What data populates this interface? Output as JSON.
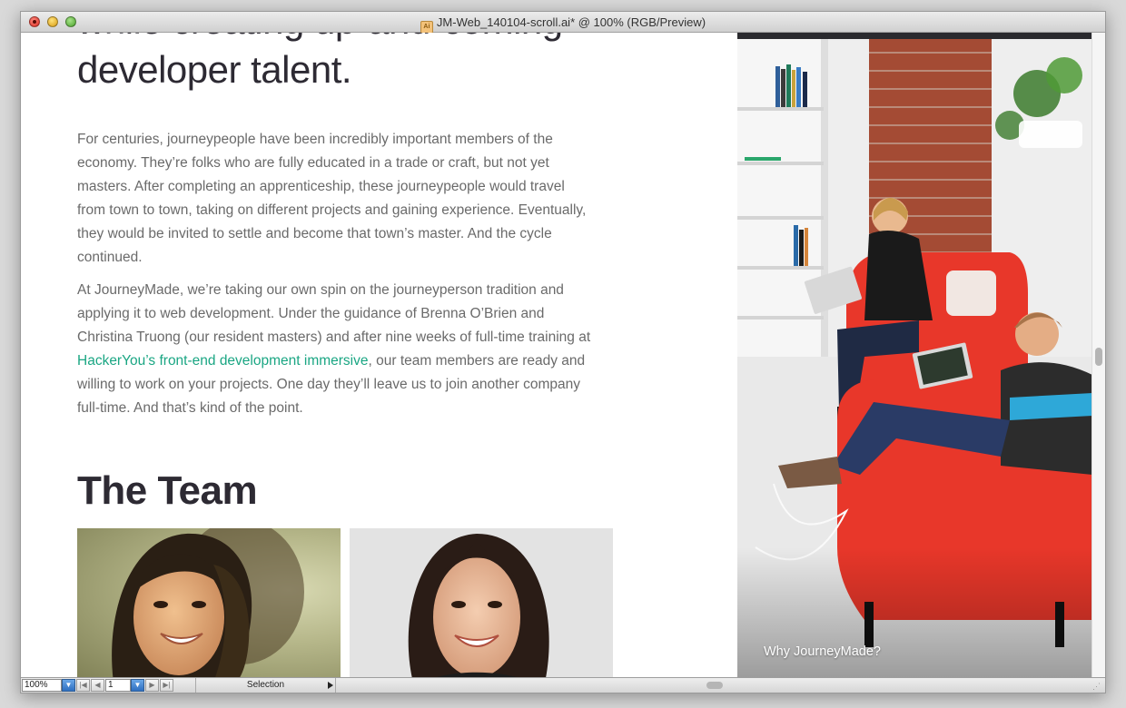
{
  "window": {
    "title": "JM-Web_140104-scroll.ai* @ 100% (RGB/Preview)",
    "doc_icon_label": "Ai"
  },
  "content": {
    "headline_line1": "while creating up-and-coming",
    "headline_line2": "developer talent.",
    "paragraph1": "For centuries, journeypeople have been incredibly important members of the economy. They’re folks who are fully educated in a trade or craft, but not yet masters. After completing an apprenticeship, these journeypeople would travel from town to town, taking on different projects and gaining experience. Eventually, they would be invited to settle and become that town’s master. And the cycle continued.",
    "paragraph2_before_link": "At JourneyMade, we’re taking our own spin on the journeyperson tradition and applying it to web development. Under the guidance of Brenna O’Brien and Christina Truong (our resident masters) and after nine weeks of full-time training at ",
    "paragraph2_link": "HackerYou’s front-end development immersive",
    "paragraph2_after_link": ", our team members are ready and willing to work on your projects. One day they’ll leave us to join another company full-time. And that’s kind of the point.",
    "team_title": "The Team",
    "right_caption": "Why JourneyMade?"
  },
  "colors": {
    "link": "#1aa683",
    "heading": "#2d2a33",
    "body": "#6a6a6a",
    "chair_red": "#e8372a"
  },
  "statusbar": {
    "zoom": "100%",
    "page": "1",
    "tool": "Selection",
    "first_page_icon": "first-page-icon",
    "prev_page_icon": "prev-page-icon",
    "next_page_icon": "next-page-icon",
    "last_page_icon": "last-page-icon"
  }
}
